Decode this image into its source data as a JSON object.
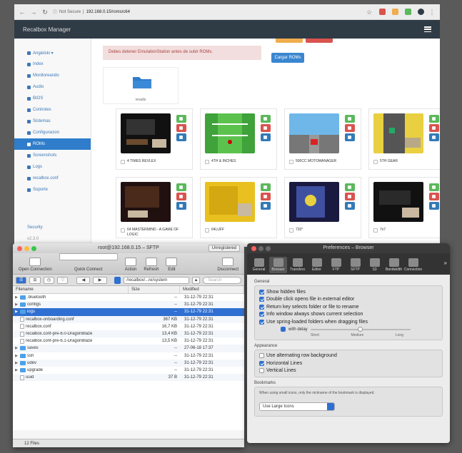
{
  "browser": {
    "address_warning": "Not Secure",
    "address_url": "192.168.0.15/roms/c64",
    "colors": {
      "ext1": "#d9534f",
      "ext2": "#f0ad4e",
      "ext3": "#5cb85c",
      "ext4": "#2f3b45"
    }
  },
  "recalbox": {
    "brand": "Recalbox Manager",
    "sidebar": [
      {
        "label": "Angielski ▾",
        "active": false
      },
      {
        "label": "Index",
        "active": false
      },
      {
        "label": "Monitoreando",
        "active": false
      },
      {
        "label": "Audio",
        "active": false
      },
      {
        "label": "BIOS",
        "active": false
      },
      {
        "label": "Controles",
        "active": false
      },
      {
        "label": "Sistemas",
        "active": false
      },
      {
        "label": "Configuracion",
        "active": false
      },
      {
        "label": "ROMs",
        "active": true
      },
      {
        "label": "Screenshots",
        "active": false
      },
      {
        "label": "Logs",
        "active": false
      },
      {
        "label": "recalbox.conf",
        "active": false
      },
      {
        "label": "Soporte",
        "active": false
      }
    ],
    "security_label": "Security",
    "version": "v2.3.0",
    "alert": "Debes detener EmulationStation antes de subir ROMs.",
    "load_roms": "Cargar ROMs",
    "folder_label": "results",
    "roms": [
      {
        "name": "4 TIMES REVLEX",
        "theme": "dark"
      },
      {
        "name": "4TH & INCHES",
        "theme": "field"
      },
      {
        "name": "500CC MOTOMANAGER",
        "theme": "race"
      },
      {
        "name": "5TH GEAR",
        "theme": "road"
      },
      {
        "name": "64 MASTERMIND - A GAME OF LOGIC",
        "theme": "dark2"
      },
      {
        "name": "64LUFF",
        "theme": "yellow"
      },
      {
        "name": "720°",
        "theme": "skate"
      },
      {
        "name": "7x7",
        "theme": "dark3"
      }
    ]
  },
  "sftp": {
    "title": "root@192.168.0.15 – SFTP",
    "unregistered": "Unregistered",
    "toolbar": {
      "open_connection": "Open Connection",
      "quick_connect": "Quick Connect",
      "action": "Action",
      "refresh": "Refresh",
      "edit": "Edit",
      "disconnect": "Disconnect"
    },
    "path": "/recalbox/...re/system",
    "search_placeholder": "Search",
    "columns": {
      "filename": "Filename",
      "size": "Size",
      "modified": "Modified"
    },
    "files": [
      {
        "name": ".bluetooth",
        "type": "folder",
        "disclosure": "▶",
        "size": "--",
        "modified": "31-12-79 22:31",
        "selected": false
      },
      {
        "name": "configs",
        "type": "folder",
        "disclosure": "▶",
        "size": "--",
        "modified": "31-12-79 22:31",
        "selected": false
      },
      {
        "name": "logs",
        "type": "folder",
        "disclosure": "▶",
        "size": "--",
        "modified": "31-12-79 22:31",
        "selected": true
      },
      {
        "name": "recalbox-onboarding.conf",
        "type": "file",
        "disclosure": "",
        "size": "367 KB",
        "modified": "31-12-79 22:31",
        "selected": false
      },
      {
        "name": "recalbox.conf",
        "type": "file",
        "disclosure": "",
        "size": "16,7 KB",
        "modified": "31-12-79 22:31",
        "selected": false
      },
      {
        "name": "recalbox.conf-pre-6.0-DragonBlaze",
        "type": "file",
        "disclosure": "",
        "size": "13,4 KB",
        "modified": "31-12-79 22:31",
        "selected": false
      },
      {
        "name": "recalbox.conf-pre-6.1-DragonBlaze",
        "type": "file",
        "disclosure": "",
        "size": "13,5 KB",
        "modified": "31-12-79 22:31",
        "selected": false
      },
      {
        "name": "saves",
        "type": "folder",
        "disclosure": "▶",
        "size": "--",
        "modified": "27-06-18 17:37",
        "selected": false
      },
      {
        "name": "ssh",
        "type": "folder",
        "disclosure": "▶",
        "size": "--",
        "modified": "31-12-79 22:31",
        "selected": false
      },
      {
        "name": "udev",
        "type": "folder",
        "disclosure": "▶",
        "size": "--",
        "modified": "31-12-79 22:31",
        "selected": false
      },
      {
        "name": "upgrade",
        "type": "folder",
        "disclosure": "▶",
        "size": "--",
        "modified": "31-12-79 22:31",
        "selected": false
      },
      {
        "name": "uuid",
        "type": "file",
        "disclosure": "",
        "size": "37 B",
        "modified": "31-12-79 22:31",
        "selected": false
      }
    ],
    "status": "12 Files"
  },
  "prefs": {
    "title": "Preferences – Browser",
    "tabs": [
      {
        "label": "General",
        "active": false
      },
      {
        "label": "Browser",
        "active": true
      },
      {
        "label": "Transfers",
        "active": false
      },
      {
        "label": "Editor",
        "active": false
      },
      {
        "label": "FTP",
        "active": false
      },
      {
        "label": "SFTP",
        "active": false
      },
      {
        "label": "S3",
        "active": false
      },
      {
        "label": "Bandwidth",
        "active": false
      },
      {
        "label": "Connection",
        "active": false
      }
    ],
    "more": "»",
    "general_label": "General",
    "general_options": [
      {
        "label": "Show hidden files",
        "checked": true
      },
      {
        "label": "Double click opens file in external editor",
        "checked": true
      },
      {
        "label": "Return key selects folder or file to rename",
        "checked": true
      },
      {
        "label": "Info window always shows current selection",
        "checked": true
      },
      {
        "label": "Use spring-loaded folders when dragging files",
        "checked": true
      }
    ],
    "with_delay": {
      "label": "with delay",
      "checked": true
    },
    "delay_level": 0.5,
    "slider_labels": [
      "Short",
      "Medium",
      "Long"
    ],
    "appearance_label": "Appearance",
    "appearance_options": [
      {
        "label": "Use alternating row background",
        "checked": false
      },
      {
        "label": "Horizontal Lines",
        "checked": true
      },
      {
        "label": "Vertical Lines",
        "checked": false
      }
    ],
    "bookmarks_label": "Bookmarks",
    "bookmarks_text": "When using small icons, only the nickname of the bookmark is displayed.",
    "icon_size": "Use Large Icons"
  }
}
